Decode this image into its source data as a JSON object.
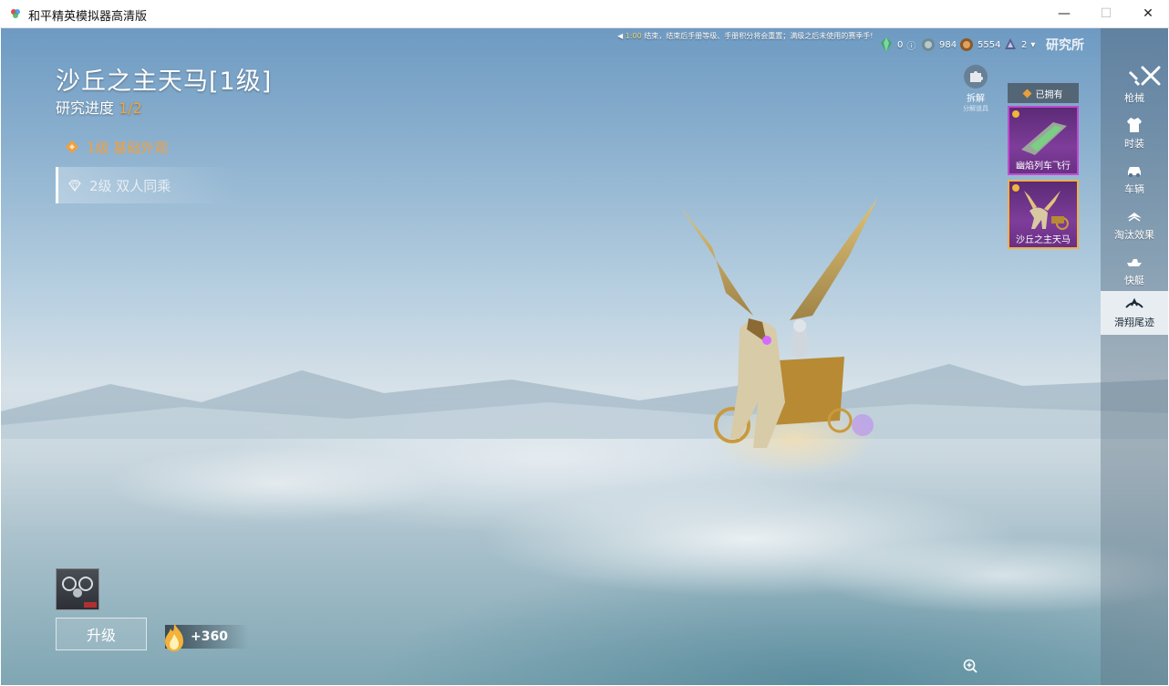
{
  "window": {
    "title": "和平精英模拟器高清版",
    "minimize": "—",
    "maximize": "☐",
    "close": "✕"
  },
  "notice": {
    "time": "1:00",
    "text": "结束，结束后手册等级、手册积分将会重置；满级之后未使用的赛季手!"
  },
  "currencies": [
    {
      "icon": "green-gem-icon",
      "value": "0"
    },
    {
      "icon": "silver-coin-icon",
      "value": "984"
    },
    {
      "icon": "gold-coin-icon",
      "value": "5554"
    },
    {
      "icon": "ticket-icon",
      "value": "2"
    }
  ],
  "lab_title": "研究所",
  "item": {
    "title": "沙丘之主天马[1级]",
    "progress_label": "研究进度",
    "progress_value": "1/2"
  },
  "levels": [
    {
      "label": "1级 基础外观",
      "state": "unlocked"
    },
    {
      "label": "2级 双人同乘",
      "state": "locked"
    }
  ],
  "dismantle": {
    "label": "拆解",
    "sub": "分解道具"
  },
  "owned": {
    "tag": "已拥有",
    "items": [
      {
        "name": "幽焰列车飞行"
      },
      {
        "name": "沙丘之主天马"
      }
    ]
  },
  "sidebar": {
    "items": [
      {
        "label": "枪械",
        "icon": "gun-icon"
      },
      {
        "label": "时装",
        "icon": "outfit-icon"
      },
      {
        "label": "车辆",
        "icon": "car-icon"
      },
      {
        "label": "淘汰效果",
        "icon": "elimination-icon"
      },
      {
        "label": "快艇",
        "icon": "boat-icon"
      },
      {
        "label": "滑翔尾迹",
        "icon": "glider-trail-icon",
        "active": true
      }
    ]
  },
  "actions": {
    "upgrade_label": "升级",
    "points": "+360"
  },
  "colors": {
    "accent_orange": "#f0a040",
    "card_purple": "#7e3d9a",
    "card_border_selected": "#f0b048"
  }
}
